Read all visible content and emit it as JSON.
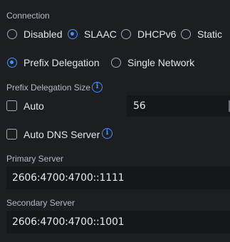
{
  "connection": {
    "label": "Connection",
    "options": [
      "Disabled",
      "SLAAC",
      "DHCPv6",
      "Static"
    ],
    "selected": "SLAAC"
  },
  "delegation_mode": {
    "options": [
      "Prefix Delegation",
      "Single Network"
    ],
    "selected": "Prefix Delegation"
  },
  "prefix_size": {
    "label": "Prefix Delegation Size",
    "auto_label": "Auto",
    "auto_checked": false,
    "value": "56"
  },
  "auto_dns": {
    "label": "Auto DNS Server",
    "checked": false
  },
  "primary_server": {
    "label": "Primary Server",
    "value": "2606:4700:4700::1111"
  },
  "secondary_server": {
    "label": "Secondary Server",
    "value": "2606:4700:4700::1001"
  },
  "colors": {
    "background": "#1c1e22",
    "accent": "#4a90ff",
    "field_background": "#15171a"
  },
  "icons": {
    "info": "info-icon"
  }
}
